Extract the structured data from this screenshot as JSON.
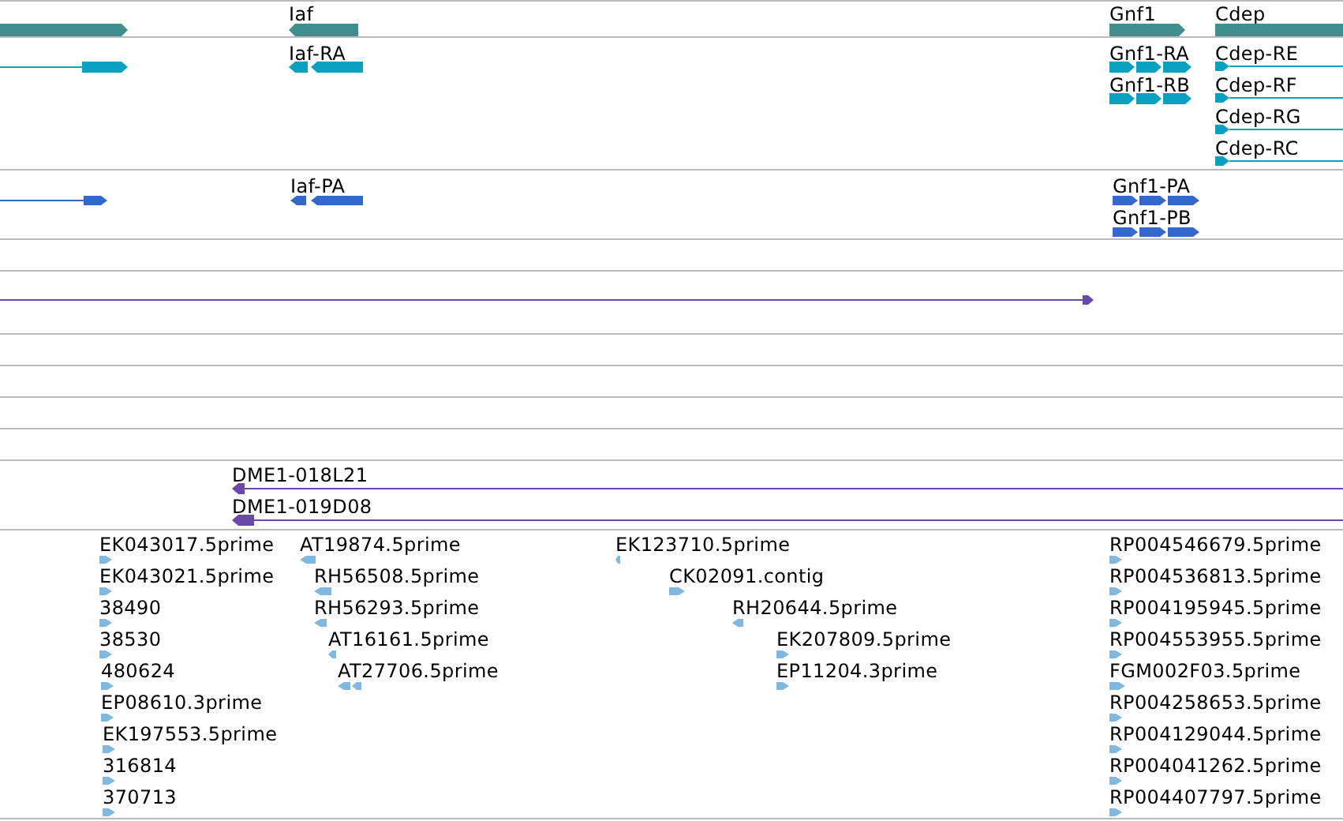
{
  "tracks": [
    {
      "features": [
        {
          "reverse": false
        },
        {
          "label": "Iaf",
          "reverse": true
        },
        {
          "label": "Gnf1",
          "reverse": false
        },
        {
          "label": "Cdep",
          "reverse": false
        }
      ]
    },
    {
      "features": [
        {
          "reverse": false
        },
        {
          "label": "Iaf-RA",
          "reverse": true
        },
        {
          "label": "Gnf1-RA",
          "reverse": false
        },
        {
          "label": "Gnf1-RB",
          "reverse": false
        },
        {
          "label": "Cdep-RE",
          "reverse": false
        },
        {
          "label": "Cdep-RF",
          "reverse": false
        },
        {
          "label": "Cdep-RG",
          "reverse": false
        },
        {
          "label": "Cdep-RC",
          "reverse": false
        }
      ]
    },
    {
      "features": [
        {
          "reverse": false
        },
        {
          "label": "Iaf-PA",
          "reverse": true
        },
        {
          "label": "Gnf1-PA",
          "reverse": false
        },
        {
          "label": "Gnf1-PB",
          "reverse": false
        }
      ]
    },
    {
      "features": [
        {
          "reverse": false
        }
      ]
    },
    {
      "features": [
        {
          "label": "DME1-018L21",
          "reverse": true
        },
        {
          "label": "DME1-019D08",
          "reverse": true
        }
      ]
    },
    {
      "features": [
        {
          "label": "EK043017.5prime",
          "reverse": false
        },
        {
          "label": "EK043021.5prime",
          "reverse": false
        },
        {
          "label": "38490",
          "reverse": false
        },
        {
          "label": "38530",
          "reverse": false
        },
        {
          "label": "480624",
          "reverse": false
        },
        {
          "label": "EP08610.3prime",
          "reverse": false
        },
        {
          "label": "EK197553.5prime",
          "reverse": false
        },
        {
          "label": "316814",
          "reverse": false
        },
        {
          "label": "370713",
          "reverse": false
        },
        {
          "label": "AT19874.5prime",
          "reverse": true
        },
        {
          "label": "RH56508.5prime",
          "reverse": true
        },
        {
          "label": "RH56293.5prime",
          "reverse": true
        },
        {
          "label": "AT16161.5prime",
          "reverse": true
        },
        {
          "label": "AT27706.5prime",
          "reverse": true
        },
        {
          "label": "EK123710.5prime",
          "reverse": true
        },
        {
          "label": "CK02091.contig",
          "reverse": false
        },
        {
          "label": "RH20644.5prime",
          "reverse": true
        },
        {
          "label": "EK207809.5prime",
          "reverse": false
        },
        {
          "label": "EP11204.3prime",
          "reverse": false
        },
        {
          "label": "RP004546679.5prime",
          "reverse": false
        },
        {
          "label": "RP004536813.5prime",
          "reverse": false
        },
        {
          "label": "RP004195945.5prime",
          "reverse": false
        },
        {
          "label": "RP004553955.5prime",
          "reverse": false
        },
        {
          "label": "FGM002F03.5prime",
          "reverse": false
        },
        {
          "label": "RP004258653.5prime",
          "reverse": false
        },
        {
          "label": "RP004129044.5prime",
          "reverse": false
        },
        {
          "label": "RP004041262.5prime",
          "reverse": false
        },
        {
          "label": "RP004407797.5prime",
          "reverse": false
        }
      ]
    }
  ]
}
